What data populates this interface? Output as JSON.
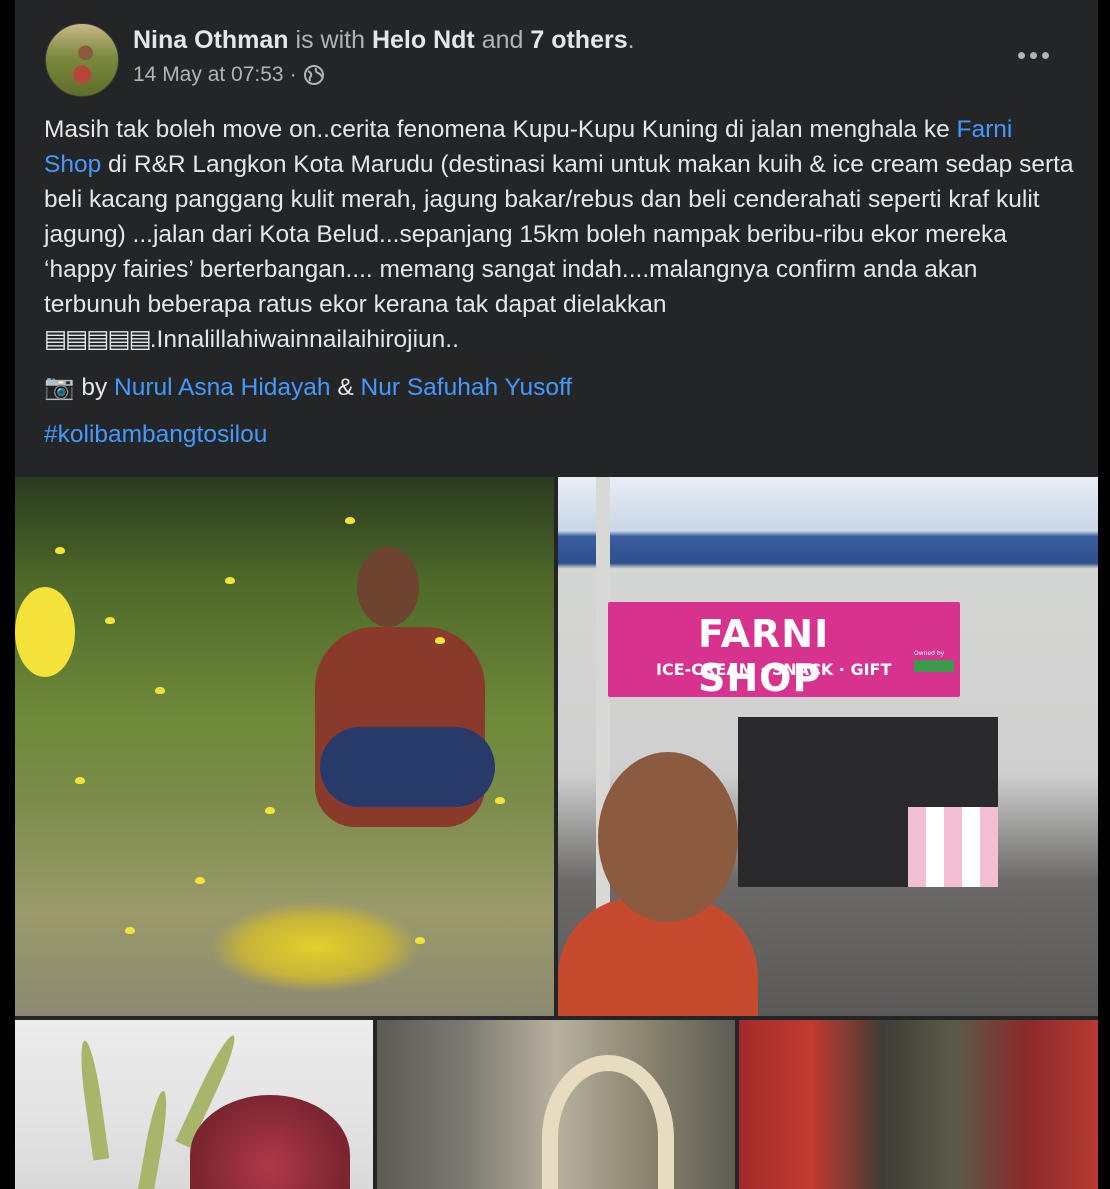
{
  "post": {
    "author": "Nina Othman",
    "with_text": "is with",
    "tagged": "Helo Ndt",
    "and_text": "and",
    "others": "7 others",
    "period": ".",
    "timestamp": "14 May at 07:53",
    "separator": "·",
    "privacy_icon": "globe-icon",
    "more_icon": "more-options-icon"
  },
  "body": {
    "p1": "Masih tak boleh move on..cerita fenomena Kupu-Kupu Kuning di jalan menghala ke ",
    "link_shop": "Farni Shop",
    "p2": " di R&R Langkon Kota Marudu (destinasi kami untuk makan kuih & ice cream sedap serta beli kacang panggang kulit merah, jagung bakar/rebus dan beli cenderahati seperti kraf kulit jagung) ...jalan dari Kota Belud...sepanjang 15km boleh nampak beribu-ribu ekor mereka ‘happy fairies’ berterbangan.... memang sangat indah....malangnya confirm anda akan terbunuh beberapa ratus ekor kerana tak dapat dielakkan ",
    "blocks": "▤▤▤▤▤",
    "p3": ".Innalillahiwainnailaihirojiun.."
  },
  "credit": {
    "camera_icon": "camera-icon",
    "camera_glyph": "📷",
    "by": " by ",
    "person1": "Nurul Asna Hidayah",
    "amp": " & ",
    "person2": "Nur Safuhah Yusoff"
  },
  "hashtag": "#kolibambangtosilou",
  "photos": {
    "shop_sign_name": "FARNI SHOP",
    "shop_sign_tagline": "ICE-CREAM · SNACK · GIFT",
    "shop_sign_owned": "Owned by"
  },
  "colors": {
    "background": "#000000",
    "card": "#242526",
    "link": "#4599ff",
    "text": "#e4e6eb",
    "secondary": "#b0b3b8"
  }
}
